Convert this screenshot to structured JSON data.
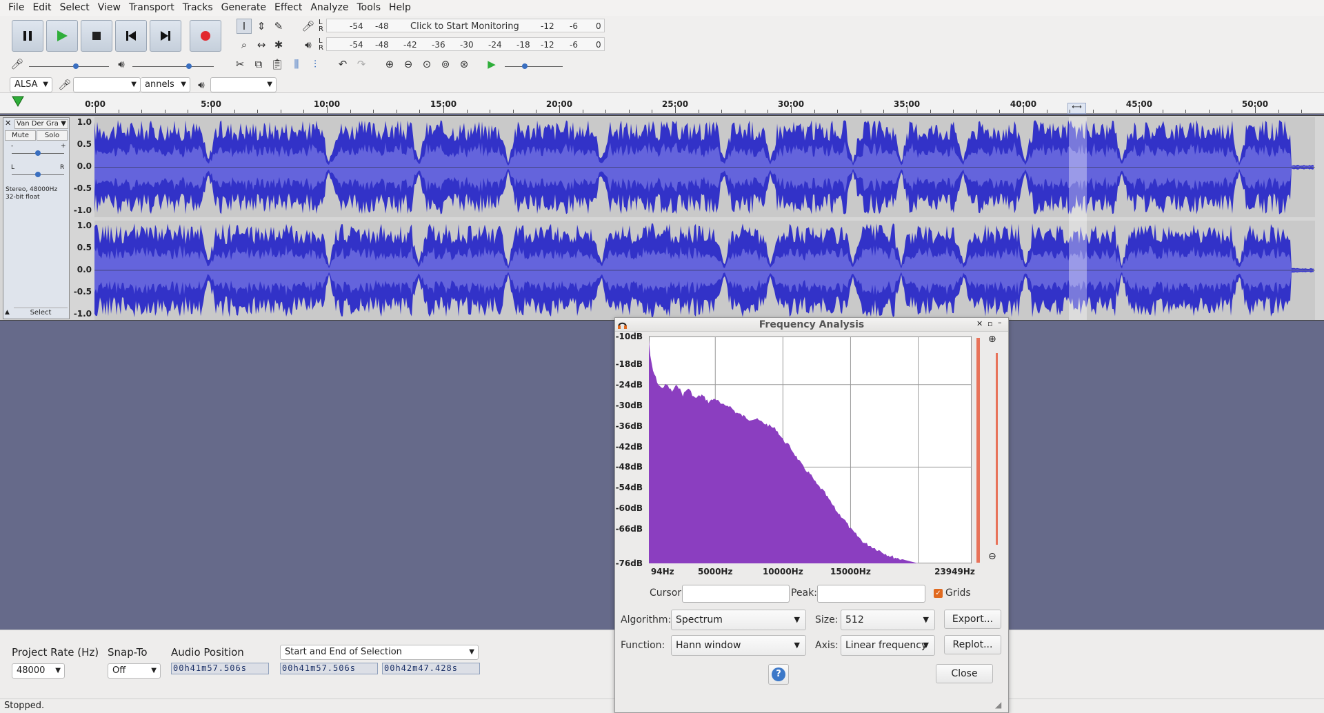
{
  "menu": [
    "File",
    "Edit",
    "Select",
    "View",
    "Transport",
    "Tracks",
    "Generate",
    "Effect",
    "Analyze",
    "Tools",
    "Help"
  ],
  "meters": {
    "record_ticks": [
      "-54",
      "-48"
    ],
    "record_msg": "Click to Start Monitoring",
    "record_ticks_right": [
      "-12",
      "-6",
      "0"
    ],
    "play_ticks": [
      "-54",
      "-48",
      "-42",
      "-36",
      "-30",
      "-24",
      "-18",
      "-12",
      "-6",
      "0"
    ],
    "lr": [
      "L",
      "R"
    ]
  },
  "device": {
    "host": "ALSA",
    "channels": "annels"
  },
  "ruler": [
    "0:00",
    "5:00",
    "10:00",
    "15:00",
    "20:00",
    "25:00",
    "30:00",
    "35:00",
    "40:00",
    "45:00",
    "50:00"
  ],
  "track": {
    "name": "Van Der Gra",
    "mute": "Mute",
    "solo": "Solo",
    "info": "Stereo, 48000Hz",
    "format": "32-bit float",
    "select": "Select",
    "pan_left": "L",
    "pan_right": "R",
    "gain_minus": "-",
    "gain_plus": "+",
    "scale": [
      "1.0",
      "0.5",
      "0.0",
      "-0.5",
      "-1.0"
    ],
    "waveform_color": "#3232c8",
    "rms_color": "#6464dc"
  },
  "bottom": {
    "rate_label": "Project Rate (Hz)",
    "rate_value": "48000",
    "snap_label": "Snap-To",
    "snap_value": "Off",
    "pos_label": "Audio Position",
    "sel_mode": "Start and End of Selection",
    "pos_time": "00h41m57.506s",
    "sel_start": "00h41m57.506s",
    "sel_end": "00h42m47.428s"
  },
  "status": "Stopped.",
  "dialog": {
    "title": "Frequency Analysis",
    "cursor_label": "Cursor:",
    "peak_label": "Peak:",
    "grids_label": "Grids",
    "grids_checked": true,
    "algorithm_label": "Algorithm:",
    "algorithm_value": "Spectrum",
    "size_label": "Size:",
    "size_value": "512",
    "function_label": "Function:",
    "function_value": "Hann window",
    "axis_label": "Axis:",
    "axis_value": "Linear frequency",
    "export_label": "Export...",
    "replot_label": "Replot...",
    "close_label": "Close",
    "help_glyph": "?",
    "fill_color": "#8b3ec0"
  },
  "chart_data": {
    "type": "area",
    "title": "",
    "xlabel": "",
    "ylabel": "",
    "x_ticks": [
      "94Hz",
      "5000Hz",
      "10000Hz",
      "15000Hz",
      "23949Hz"
    ],
    "y_ticks": [
      "-10dB",
      "-18dB",
      "-24dB",
      "-30dB",
      "-36dB",
      "-42dB",
      "-48dB",
      "-54dB",
      "-60dB",
      "-66dB",
      "-76dB"
    ],
    "xlim": [
      94,
      23949
    ],
    "ylim": [
      -76,
      -10
    ],
    "grid": true,
    "x": [
      94,
      200,
      400,
      600,
      800,
      1000,
      1400,
      1800,
      2200,
      2600,
      3000,
      3500,
      4000,
      4500,
      5000,
      5500,
      6000,
      6500,
      7000,
      7500,
      8000,
      8500,
      9000,
      9500,
      10000,
      10500,
      11000,
      11500,
      12000,
      12500,
      13000,
      13500,
      14000,
      14500,
      15000,
      15500,
      16000,
      17000,
      18000,
      19000,
      20000,
      21000,
      22000,
      23000,
      23949
    ],
    "values": [
      -11,
      -16,
      -20,
      -22,
      -24,
      -25,
      -24,
      -26,
      -24,
      -27,
      -25,
      -28,
      -27,
      -29,
      -28,
      -30,
      -30,
      -32,
      -33,
      -34,
      -34,
      -35,
      -36,
      -37,
      -40,
      -42,
      -45,
      -48,
      -50,
      -53,
      -55,
      -58,
      -61,
      -63,
      -66,
      -68,
      -70,
      -72,
      -74,
      -75,
      -76,
      -76,
      -76,
      -76,
      -76
    ]
  }
}
